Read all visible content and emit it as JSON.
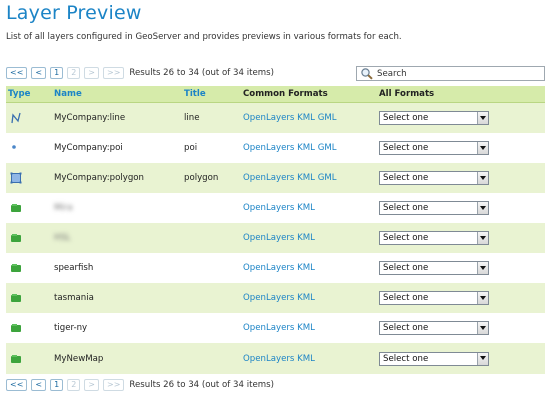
{
  "page": {
    "title": "Layer Preview",
    "description": "List of all layers configured in GeoServer and provides previews in various formats for each."
  },
  "pager": {
    "first": "<<",
    "prev": "<",
    "page1": "1",
    "page2": "2",
    "next": ">",
    "last": ">>",
    "summary": "Results 26 to 34 (out of 34 items)"
  },
  "search": {
    "placeholder": "Search",
    "icon": "magnifier-icon"
  },
  "table": {
    "headers": {
      "type": "Type",
      "name": "Name",
      "title": "Title",
      "common": "Common Formats",
      "all": "All Formats"
    },
    "rows": [
      {
        "type": "line-icon",
        "name": "MyCompany:line",
        "title": "line",
        "openlayers": "OpenLayers",
        "kml": "KML",
        "gml": "GML",
        "select": "Select one"
      },
      {
        "type": "point-icon",
        "name": "MyCompany:poi",
        "title": "poi",
        "openlayers": "OpenLayers",
        "kml": "KML",
        "gml": "GML",
        "select": "Select one"
      },
      {
        "type": "polygon-icon",
        "name": "MyCompany:polygon",
        "title": "polygon",
        "openlayers": "OpenLayers",
        "kml": "KML",
        "gml": "GML",
        "select": "Select one"
      },
      {
        "type": "layer-group-icon",
        "name": "Mira",
        "title": "",
        "openlayers": "OpenLayers",
        "kml": "KML",
        "gml": "",
        "select": "Select one"
      },
      {
        "type": "layer-group-icon",
        "name": "HSL",
        "title": "",
        "openlayers": "OpenLayers",
        "kml": "KML",
        "gml": "",
        "select": "Select one"
      },
      {
        "type": "layer-group-icon",
        "name": "spearfish",
        "title": "",
        "openlayers": "OpenLayers",
        "kml": "KML",
        "gml": "",
        "select": "Select one"
      },
      {
        "type": "layer-group-icon",
        "name": "tasmania",
        "title": "",
        "openlayers": "OpenLayers",
        "kml": "KML",
        "gml": "",
        "select": "Select one"
      },
      {
        "type": "layer-group-icon",
        "name": "tiger-ny",
        "title": "",
        "openlayers": "OpenLayers",
        "kml": "KML",
        "gml": "",
        "select": "Select one"
      },
      {
        "type": "layer-group-icon",
        "name": "MyNewMap",
        "title": "",
        "openlayers": "OpenLayers",
        "kml": "KML",
        "gml": "",
        "select": "Select one"
      }
    ]
  },
  "colors": {
    "accent": "#1c84c6",
    "header_bg": "#d6ebaa",
    "row_alt_bg": "#e9f3d2",
    "group_icon": "#3da43d"
  }
}
